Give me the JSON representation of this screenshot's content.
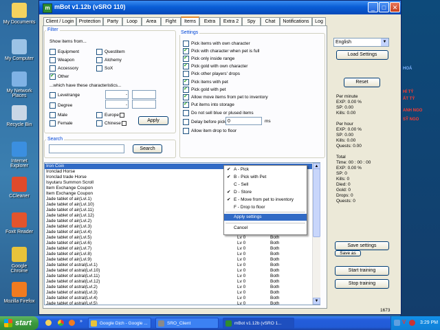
{
  "desktop": {
    "icons": [
      {
        "label": "My Documents",
        "icon": "folder-docs-icon",
        "color": "#f4d35e"
      },
      {
        "label": "My Computer",
        "icon": "computer-icon",
        "color": "#9cc3e6"
      },
      {
        "label": "My Network Places",
        "icon": "network-icon",
        "color": "#7fb2e5"
      },
      {
        "label": "Recycle Bin",
        "icon": "recycle-bin-icon",
        "color": "#c9d7e6"
      },
      {
        "label": "Internet Explorer",
        "icon": "internet-explorer-icon",
        "color": "#3b8fe0"
      },
      {
        "label": "CCleaner",
        "icon": "ccleaner-icon",
        "color": "#e04a2b"
      },
      {
        "label": "Foxit Reader",
        "icon": "foxit-reader-icon",
        "color": "#e3542c"
      },
      {
        "label": "Google Chrome",
        "icon": "chrome-icon",
        "color": "#e8c33a"
      },
      {
        "label": "Mozilla Firefox",
        "icon": "firefox-icon",
        "color": "#f07b20"
      }
    ],
    "side_texts": [
      "HÍ TỶ",
      "ẤT TỶ",
      "ANH NGO",
      "SỸ NGO",
      "HOÁ"
    ]
  },
  "window": {
    "title": "mBot v1.12b (vSRO 110)",
    "tabs": [
      "Client / Login",
      "Protection",
      "Party",
      "Loop",
      "Area",
      "Fight",
      "Items",
      "Extra",
      "Extra 2",
      "Spy",
      "Chat",
      "Notifications",
      "Log"
    ],
    "active_tab": "Items"
  },
  "filter": {
    "legend": "Filter",
    "show_label": "Show items from...",
    "col1": [
      {
        "label": "Equipment",
        "checked": false
      },
      {
        "label": "Weapon",
        "checked": false
      },
      {
        "label": "Accessory",
        "checked": false
      },
      {
        "label": "Other",
        "checked": true
      }
    ],
    "col2": [
      {
        "label": "Questitem",
        "checked": false
      },
      {
        "label": "Alchemy",
        "checked": false
      },
      {
        "label": "SoX",
        "checked": false
      }
    ],
    "characteristics_label": "...which have these characteristics...",
    "levelrange_label": "Levelrange",
    "degree_label": "Degree",
    "dash": "-",
    "gender": [
      {
        "label": "Male",
        "checked": false
      },
      {
        "label": "Female",
        "checked": false
      }
    ],
    "race": [
      {
        "label": "Europe",
        "checked": false
      },
      {
        "label": "Chinese",
        "checked": false
      }
    ],
    "apply_label": "Apply"
  },
  "search": {
    "legend": "Search",
    "value": "",
    "button_label": "Search"
  },
  "settings": {
    "legend": "Settings",
    "options": [
      {
        "label": "Pick items with own character",
        "checked": false
      },
      {
        "label": "Pick with character when pet is full",
        "checked": true
      },
      {
        "label": "Pick only inside range",
        "checked": true
      },
      {
        "label": "Pick gold with own character",
        "checked": true
      },
      {
        "label": "Pick other players' drops",
        "checked": false
      },
      {
        "label": "Pick items with pet",
        "checked": true
      },
      {
        "label": "Pick gold with pet",
        "checked": true
      },
      {
        "label": "Allow move items from pet to inventory",
        "checked": true
      },
      {
        "label": "Put items into storage",
        "checked": true
      },
      {
        "label": "Do not sell blue or plused items",
        "checked": false
      },
      {
        "label": "Delay before pick",
        "checked": false
      },
      {
        "label": "Allow item drop to floor",
        "checked": false
      }
    ],
    "delay_value": "0",
    "delay_unit": "ms"
  },
  "items": [
    {
      "name": "Iron Coin",
      "level": "",
      "gender": "",
      "selected": true
    },
    {
      "name": "Ironclad Horse",
      "level": "",
      "gender": ""
    },
    {
      "name": "Ironclad trade Horse",
      "level": "",
      "gender": ""
    },
    {
      "name": "Isyutaru Summon Scroll",
      "level": "",
      "gender": ""
    },
    {
      "name": "Item Exchange Coupon",
      "level": "",
      "gender": ""
    },
    {
      "name": "Item Exchange Coupon",
      "level": "",
      "gender": ""
    },
    {
      "name": "Jade tablet of air(Lvl.1)",
      "level": "",
      "gender": ""
    },
    {
      "name": "Jade tablet of air(Lvl.10)",
      "level": "",
      "gender": ""
    },
    {
      "name": "Jade tablet of air(Lvl.11)",
      "level": "",
      "gender": ""
    },
    {
      "name": "Jade tablet of air(Lvl.12)",
      "level": "",
      "gender": ""
    },
    {
      "name": "Jade tablet of air(Lvl.2)",
      "level": "",
      "gender": ""
    },
    {
      "name": "Jade tablet of air(Lvl.3)",
      "level": "",
      "gender": ""
    },
    {
      "name": "Jade tablet of air(Lvl.4)",
      "level": "Lv 0",
      "gender": "Both"
    },
    {
      "name": "Jade tablet of air(Lvl.5)",
      "level": "Lv 0",
      "gender": "Both"
    },
    {
      "name": "Jade tablet of air(Lvl.6)",
      "level": "Lv 0",
      "gender": "Both"
    },
    {
      "name": "Jade tablet of air(Lvl.7)",
      "level": "Lv 0",
      "gender": "Both"
    },
    {
      "name": "Jade tablet of air(Lvl.8)",
      "level": "Lv 0",
      "gender": "Both"
    },
    {
      "name": "Jade tablet of air(Lvl.9)",
      "level": "Lv 0",
      "gender": "Both"
    },
    {
      "name": "Jade tablet of astral(Lvl.1)",
      "level": "Lv 0",
      "gender": "Both"
    },
    {
      "name": "Jade tablet of astral(Lvl.10)",
      "level": "Lv 0",
      "gender": "Both"
    },
    {
      "name": "Jade tablet of astral(Lvl.11)",
      "level": "Lv 0",
      "gender": "Both"
    },
    {
      "name": "Jade tablet of astral(Lvl.12)",
      "level": "Lv 0",
      "gender": "Both"
    },
    {
      "name": "Jade tablet of astral(Lvl.2)",
      "level": "Lv 0",
      "gender": "Both"
    },
    {
      "name": "Jade tablet of astral(Lvl.3)",
      "level": "Lv 0",
      "gender": "Both"
    },
    {
      "name": "Jade tablet of astral(Lvl.4)",
      "level": "Lv 0",
      "gender": "Both"
    },
    {
      "name": "Jade tablet of astral(Lvl.5)",
      "level": "Lv 0",
      "gender": "Both"
    }
  ],
  "context_menu": {
    "items": [
      {
        "label": "A - Pick",
        "checked": true
      },
      {
        "label": "B - Pick with Pet",
        "checked": true
      },
      {
        "label": "C - Sell",
        "checked": false
      },
      {
        "label": "D - Store",
        "checked": true
      },
      {
        "label": "E - Move from pet to inventory",
        "checked": true
      },
      {
        "label": "F - Drop to floor",
        "checked": false
      }
    ],
    "apply_label": "Apply settings",
    "cancel_label": "Cancel"
  },
  "right_panel": {
    "language": "English",
    "load_settings": "Load Settings",
    "reset": "Reset",
    "per_minute": {
      "title": "Per minute",
      "lines": [
        "EXP:    0.00 %",
        "SP:     0.00",
        "Kills:   0.00"
      ]
    },
    "per_hour": {
      "title": "Per hour",
      "lines": [
        "EXP:    0.00 %",
        "SP:     0.00",
        "Kills:   0.00",
        "Quests: 0.00"
      ]
    },
    "total": {
      "title": "Total",
      "lines": [
        "Time:    00 : 00 : 00",
        "EXP:    0.00 %",
        "SP:      0",
        "Kills:    0",
        "Died:    0",
        "Gold:    0",
        "Drops:  0",
        "Quests: 0"
      ]
    },
    "save_settings": "Save settings",
    "save_as": "Save as",
    "start_training": "Start training",
    "stop_training": "Stop training",
    "status_number": "1673"
  },
  "taskbar": {
    "start": "start",
    "tasks": [
      {
        "label": "Google Dịch - Google ...",
        "icon": "chrome-icon"
      },
      {
        "label": "SRO_Client",
        "icon": "sro-client-icon"
      },
      {
        "label": "mBot v1.12b (vSRO 1...",
        "icon": "mbot-icon"
      }
    ],
    "clock": "3:29 PM"
  }
}
